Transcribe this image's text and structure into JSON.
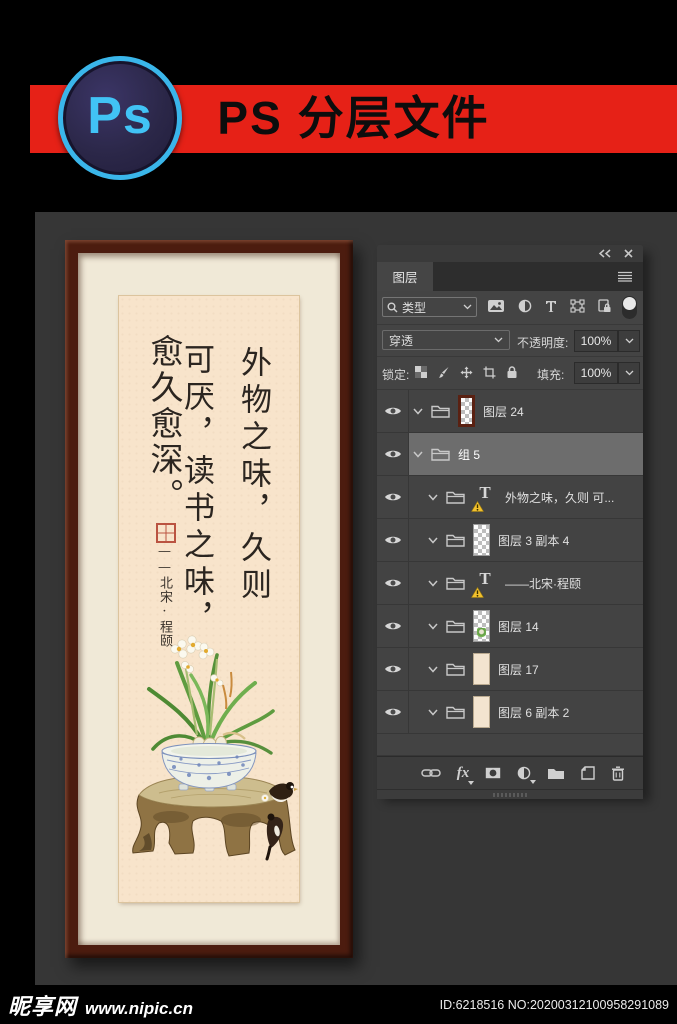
{
  "header": {
    "logo_text": "Ps",
    "title": "PS 分层文件"
  },
  "panel": {
    "tab_label": "图层",
    "filter_row": {
      "type_label": "类型"
    },
    "blend_row": {
      "mode": "穿透",
      "opacity_label": "不透明度:",
      "opacity_value": "100%"
    },
    "lock_row": {
      "label": "锁定:",
      "fill_label": "填充:",
      "fill_value": "100%"
    },
    "layers": [
      {
        "label": "图层 24",
        "type": "image",
        "thumb": "frame",
        "indent": 0,
        "selected": false
      },
      {
        "label": "组 5",
        "type": "group",
        "indent": 0,
        "selected": true
      },
      {
        "label": "外物之味，久则 可...",
        "type": "text",
        "indent": 1,
        "selected": false,
        "warning": true
      },
      {
        "label": "图层 3 副本 4",
        "type": "image",
        "thumb": "transparent",
        "indent": 1,
        "selected": false
      },
      {
        "label": "——北宋·程颐",
        "type": "text",
        "indent": 1,
        "selected": false,
        "warning": true
      },
      {
        "label": "图层 14",
        "type": "image",
        "thumb": "plant",
        "indent": 1,
        "selected": false
      },
      {
        "label": "图层 17",
        "type": "image",
        "thumb": "cream",
        "indent": 1,
        "selected": false
      },
      {
        "label": "图层 6 副本 2",
        "type": "image",
        "thumb": "cream",
        "indent": 1,
        "selected": false
      }
    ]
  },
  "artwork": {
    "calligraphy_columns": [
      "外物之味，久则",
      "可厌，读书之味，",
      "愈久愈深。"
    ],
    "signature": "——北宋·程颐"
  },
  "footer": {
    "site_name": "昵享网",
    "site_url": "www.nipic.cn",
    "id_text": "ID:6218516 NO:20200312100958291089"
  },
  "colors": {
    "banner_red": "#e62117",
    "logo_cyan": "#3ab6ea",
    "panel_bg": "#434343",
    "selected_row": "#6d6d6d",
    "frame_brown": "#4c1c0f",
    "mat_cream": "#f0e9d7",
    "paper": "#f8e4cb",
    "seal_red": "#b03a2a"
  }
}
